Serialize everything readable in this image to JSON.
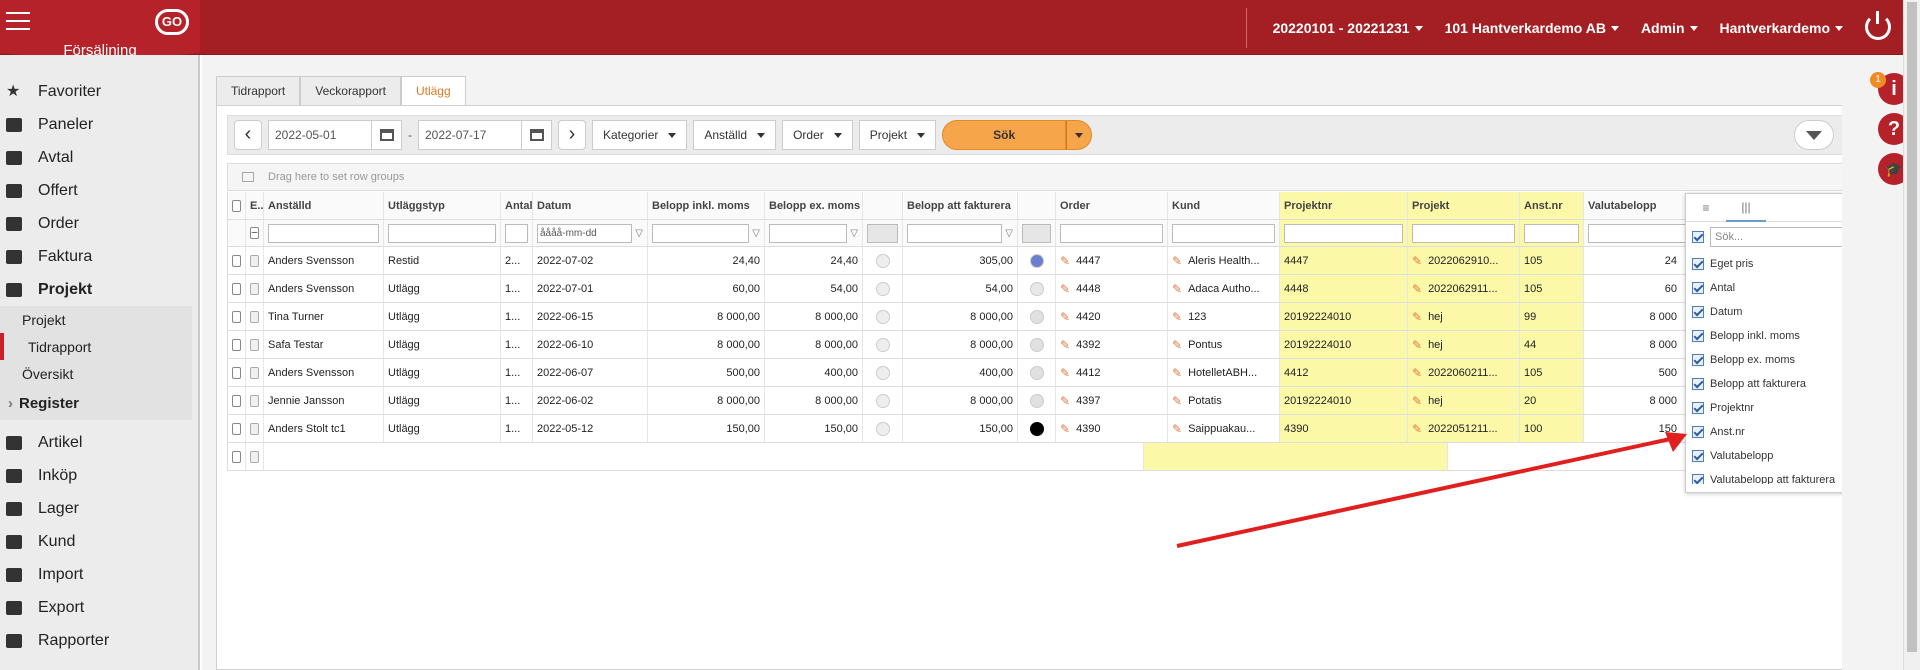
{
  "header": {
    "brand": "Försäljning",
    "logo": "GO",
    "period": "20220101 - 20221231",
    "company": "101 Hantverkardemo AB",
    "user": "Admin",
    "account": "Hantverkardemo"
  },
  "sidebar": {
    "items": [
      {
        "label": "Favoriter",
        "icon": "star-icon"
      },
      {
        "label": "Paneler",
        "icon": "gauge-icon"
      },
      {
        "label": "Avtal",
        "icon": "contract-icon"
      },
      {
        "label": "Offert",
        "icon": "document-icon"
      },
      {
        "label": "Order",
        "icon": "clipboard-icon"
      },
      {
        "label": "Faktura",
        "icon": "invoice-icon"
      },
      {
        "label": "Projekt",
        "icon": "briefcase-icon"
      }
    ],
    "project_sub": [
      "Projekt",
      "Tidrapport",
      "Översikt"
    ],
    "register": "Register",
    "items2": [
      {
        "label": "Artikel",
        "icon": "box-icon"
      },
      {
        "label": "Inköp",
        "icon": "cart-icon"
      },
      {
        "label": "Lager",
        "icon": "warehouse-icon"
      },
      {
        "label": "Kund",
        "icon": "person-icon"
      },
      {
        "label": "Import",
        "icon": "import-icon"
      },
      {
        "label": "Export",
        "icon": "export-icon"
      },
      {
        "label": "Rapporter",
        "icon": "printer-icon"
      }
    ]
  },
  "tabs": [
    "Tidrapport",
    "Veckorapport",
    "Utlägg"
  ],
  "toolbar": {
    "date_from": "2022-05-01",
    "date_to": "2022-07-17",
    "dash": "-",
    "kategorier": "Kategorier",
    "anstalld": "Anställd",
    "order": "Order",
    "projekt": "Projekt",
    "sok": "Sök"
  },
  "group_hint": "Drag here to set row groups",
  "grid": {
    "headers": [
      "E...",
      "Anställd",
      "Utläggstyp",
      "Antal",
      "Datum",
      "Belopp inkl. moms",
      "Belopp ex. moms",
      "",
      "Belopp att fakturera",
      "",
      "Order",
      "Kund",
      "Projektnr",
      "Projekt",
      "Anst.nr",
      "Valutabelopp"
    ],
    "date_placeholder": "åååå-mm-dd",
    "rows": [
      {
        "anstalld": "Anders Svensson",
        "typ": "Restid",
        "antal": "2...",
        "datum": "2022-07-02",
        "inkl": "24,40",
        "ex": "24,40",
        "fakt": "305,00",
        "dot": "#6b7fd0",
        "order": "4447",
        "kund": "Aleris Health...",
        "projnr": "4447",
        "projekt": "2022062910...",
        "anstnr": "105",
        "valuta": "24"
      },
      {
        "anstalld": "Anders Svensson",
        "typ": "Utlägg",
        "antal": "1...",
        "datum": "2022-07-01",
        "inkl": "60,00",
        "ex": "54,00",
        "fakt": "54,00",
        "dot": "#e8e8e8",
        "order": "4448",
        "kund": "Adaca Autho...",
        "projnr": "4448",
        "projekt": "2022062911...",
        "anstnr": "105",
        "valuta": "60"
      },
      {
        "anstalld": "Tina Turner",
        "typ": "Utlägg",
        "antal": "1...",
        "datum": "2022-06-15",
        "inkl": "8 000,00",
        "ex": "8 000,00",
        "fakt": "8 000,00",
        "dot": "#e0e0e0",
        "order": "4420",
        "kund": "123",
        "projnr": "20192224010",
        "projekt": "hej",
        "anstnr": "99",
        "valuta": "8 000"
      },
      {
        "anstalld": "Safa Testar",
        "typ": "Utlägg",
        "antal": "1...",
        "datum": "2022-06-10",
        "inkl": "8 000,00",
        "ex": "8 000,00",
        "fakt": "8 000,00",
        "dot": "#e0e0e0",
        "order": "4392",
        "kund": "Pontus",
        "projnr": "20192224010",
        "projekt": "hej",
        "anstnr": "44",
        "valuta": "8 000"
      },
      {
        "anstalld": "Anders Svensson",
        "typ": "Utlägg",
        "antal": "1...",
        "datum": "2022-06-07",
        "inkl": "500,00",
        "ex": "400,00",
        "fakt": "400,00",
        "dot": "#e0e0e0",
        "order": "4412",
        "kund": "HotelletABH...",
        "projnr": "4412",
        "projekt": "2022060211...",
        "anstnr": "105",
        "valuta": "500"
      },
      {
        "anstalld": "Jennie Jansson",
        "typ": "Utlägg",
        "antal": "1...",
        "datum": "2022-06-02",
        "inkl": "8 000,00",
        "ex": "8 000,00",
        "fakt": "8 000,00",
        "dot": "#e0e0e0",
        "order": "4397",
        "kund": "Potatis",
        "projnr": "20192224010",
        "projekt": "hej",
        "anstnr": "20",
        "valuta": "8 000"
      },
      {
        "anstalld": "Anders Stolt tc1",
        "typ": "Utlägg",
        "antal": "1...",
        "datum": "2022-05-12",
        "inkl": "150,00",
        "ex": "150,00",
        "fakt": "150,00",
        "dot": "#000000",
        "order": "4390",
        "kund": "Saippuakau...",
        "projnr": "4390",
        "projekt": "2022051211...",
        "anstnr": "100",
        "valuta": "150"
      }
    ]
  },
  "column_panel": {
    "search_placeholder": "Sök...",
    "items": [
      "Eget pris",
      "Antal",
      "Datum",
      "Belopp inkl. moms",
      "Belopp ex. moms",
      "Belopp att fakturera",
      "Projektnr",
      "Anst.nr",
      "Valutabelopp",
      "Valutabelopp att fakturera"
    ]
  },
  "rightbar": {
    "badge": "1"
  },
  "colors": {
    "brand": "#a31f24",
    "accent": "#f7a54b",
    "highlight": "#fbf8a8",
    "annotation_arrow": "#e0201e"
  }
}
